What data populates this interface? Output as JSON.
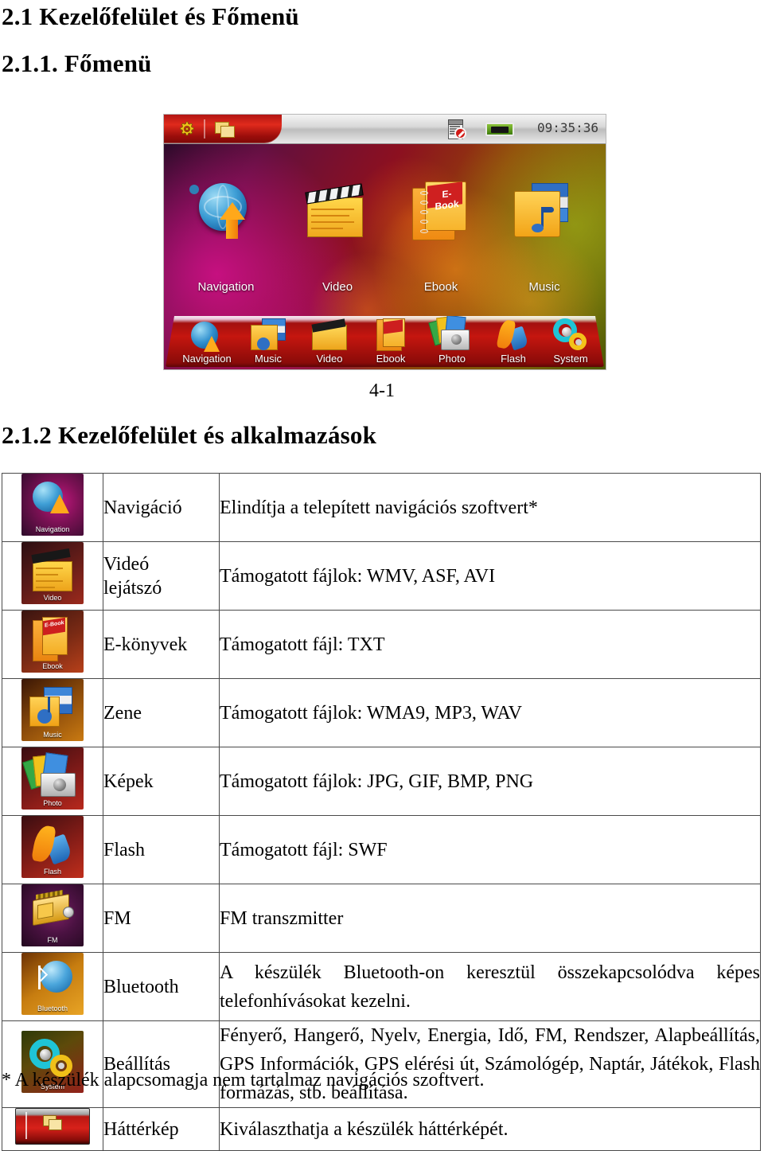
{
  "headings": {
    "section_211": "2.1 Kezelőfelület és Főmenü",
    "section_2111": "2.1.1. Főmenü",
    "section_212": "2.1.2 Kezelőfelület és alkalmazások"
  },
  "figure": {
    "caption": "4-1",
    "statusbar": {
      "gear_icon": "gear-icon",
      "windows_icon": "windows-icon",
      "document_blocked_icon": "document-blocked-icon",
      "battery_icon": "battery-icon",
      "clock": "09:35:36"
    },
    "main_grid": [
      {
        "label": "Navigation",
        "icon": "globe-arrow-icon"
      },
      {
        "label": "Video",
        "icon": "clapperboard-icon"
      },
      {
        "label": "Ebook",
        "icon": "book-icon"
      },
      {
        "label": "Music",
        "icon": "music-folder-icon"
      }
    ],
    "dock": [
      {
        "label": "Navigation",
        "icon": "globe-arrow-icon"
      },
      {
        "label": "Music",
        "icon": "music-folder-icon"
      },
      {
        "label": "Video",
        "icon": "clapperboard-icon"
      },
      {
        "label": "Ebook",
        "icon": "book-icon"
      },
      {
        "label": "Photo",
        "icon": "camera-photos-icon"
      },
      {
        "label": "Flash",
        "icon": "flash-icon"
      },
      {
        "label": "System",
        "icon": "gears-icon"
      }
    ]
  },
  "table": {
    "rows": [
      {
        "icon_label": "Navigation",
        "icon": "navigation-app-icon",
        "name": "Navigáció",
        "desc": "Elindítja a telepített navigációs szoftvert*"
      },
      {
        "icon_label": "Video",
        "icon": "video-app-icon",
        "name": "Videó lejátszó",
        "name_line1": "Videó",
        "name_line2": "lejátszó",
        "desc": "Támogatott fájlok: WMV, ASF, AVI"
      },
      {
        "icon_label": "Ebook",
        "icon": "ebook-app-icon",
        "name": "E-könyvek",
        "desc": "Támogatott fájl: TXT"
      },
      {
        "icon_label": "Music",
        "icon": "music-app-icon",
        "name": "Zene",
        "desc": "Támogatott fájlok: WMA9, MP3, WAV"
      },
      {
        "icon_label": "Photo",
        "icon": "photo-app-icon",
        "name": "Képek",
        "desc": "Támogatott fájlok: JPG, GIF, BMP, PNG"
      },
      {
        "icon_label": "Flash",
        "icon": "flash-app-icon",
        "name": "Flash",
        "desc": "Támogatott fájl: SWF"
      },
      {
        "icon_label": "FM",
        "icon": "fm-app-icon",
        "name": "FM",
        "desc": "FM transzmitter"
      },
      {
        "icon_label": "Bluetooth",
        "icon": "bluetooth-app-icon",
        "name": "Bluetooth",
        "desc": "A készülék Bluetooth-on keresztül összekapcsolódva képes telefonhívásokat kezelni."
      },
      {
        "icon_label": "System",
        "icon": "system-app-icon",
        "name": "Beállítás",
        "desc": "Fényerő, Hangerő, Nyelv, Energia, Idő, FM, Rendszer, Alapbeállítás, GPS Információk, GPS elérési út, Számológép, Naptár, Játékok, Flash formázás, stb. beállítása."
      },
      {
        "icon_label": "",
        "icon": "wallpaper-app-icon",
        "name": "Háttérkép",
        "desc": "Kiválaszthatja a készülék háttérképét."
      }
    ]
  },
  "footnote": "* A készülék alapcsomagja nem tartalmaz navigációs szoftvert."
}
